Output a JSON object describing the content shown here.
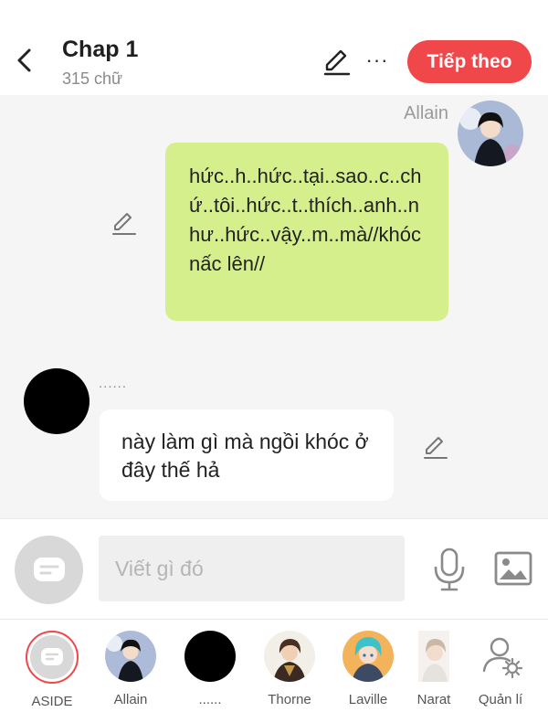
{
  "header": {
    "title": "Chap 1",
    "word_count": "315 chữ",
    "next_label": "Tiếp theo",
    "more_glyph": "···"
  },
  "messages": [
    {
      "sender": "Allain",
      "side": "right",
      "text": "hức..h..hức..tại..sao..c..chứ..tôi..hức..t..thích..anh..như..hức..vậy..m..mà//khóc nấc lên//"
    },
    {
      "sender": "......",
      "side": "left",
      "text": "này làm gì mà ngồi khóc ở đây thế hả"
    }
  ],
  "composer": {
    "placeholder": "Viết gì đó"
  },
  "characters": [
    {
      "name": "ASIDE",
      "selected": true
    },
    {
      "name": "Allain"
    },
    {
      "name": "......"
    },
    {
      "name": "Thorne"
    },
    {
      "name": "Laville"
    },
    {
      "name": "Narat"
    },
    {
      "name": "Quản lí"
    }
  ],
  "colors": {
    "accent": "#f0474a",
    "bubble_right": "#d6ef8d",
    "bubble_left": "#ffffff",
    "background": "#f5f5f5"
  }
}
